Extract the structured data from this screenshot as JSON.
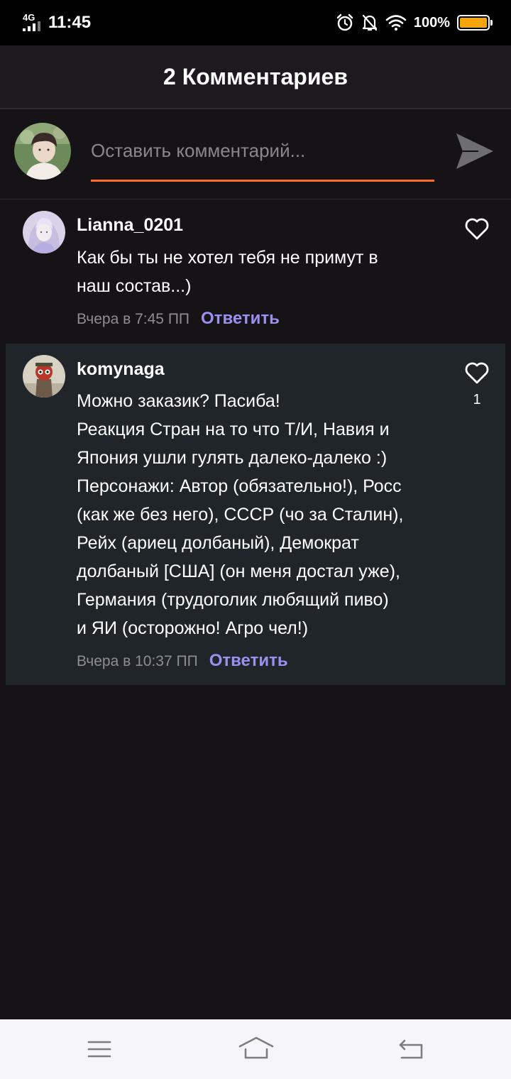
{
  "status_bar": {
    "network": "4G",
    "time": "11:45",
    "battery_percent": "100%",
    "battery_color": "#f5a50a",
    "icons": [
      "alarm-icon",
      "bell-off-icon",
      "wifi-icon",
      "battery-icon"
    ]
  },
  "header": {
    "title": "2 Комментариев"
  },
  "compose": {
    "placeholder": "Оставить комментарий...",
    "value": "",
    "underline_color": "#ff6a2c"
  },
  "comments": [
    {
      "username": "Lianna_0201",
      "text_lines": [
        "Как бы ты не хотел тебя не примут в",
        "наш состав...)"
      ],
      "time": "Вчера в 7:45 ПП",
      "reply_label": "Ответить",
      "likes": ""
    },
    {
      "username": "komynaga",
      "text_lines": [
        "Можно заказик? Пасиба!",
        "Реакция Стран на то что Т/И, Навия и",
        "Япония ушли гулять далеко-далеко :)",
        "Персонажи: Автор (обязательно!), Росс",
        "(как же без него), СССР (чо за Сталин),",
        "Рейх (ариец долбаный), Демократ",
        "долбаный [США] (он меня достал уже),",
        "Германия (трудоголик любящий пиво)",
        "и ЯИ (осторожно! Агро чел!)"
      ],
      "time": "Вчера в 10:37 ПП",
      "reply_label": "Ответить",
      "likes": "1"
    }
  ],
  "accent_colors": {
    "reply": "#9b8ff0",
    "highlighted_comment_bg": "#1f2528"
  },
  "nav_bar": {
    "icons": [
      "menu-icon",
      "home-icon",
      "back-icon"
    ]
  }
}
